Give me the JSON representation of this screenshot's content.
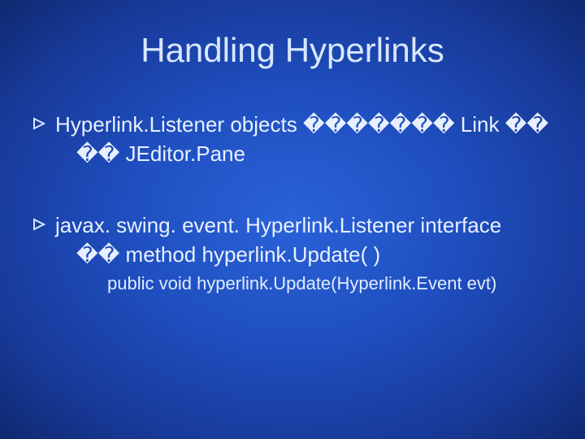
{
  "title": "Handling Hyperlinks",
  "bullets": [
    {
      "line1": "Hyperlink.Listener objects  ������� Link ��",
      "line2": "�� JEditor.Pane"
    },
    {
      "line1": "javax. swing. event. Hyperlink.Listener interface",
      "line2": "�� method hyperlink.Update( )",
      "sub": "public void hyperlink.Update(Hyperlink.Event evt)"
    }
  ]
}
